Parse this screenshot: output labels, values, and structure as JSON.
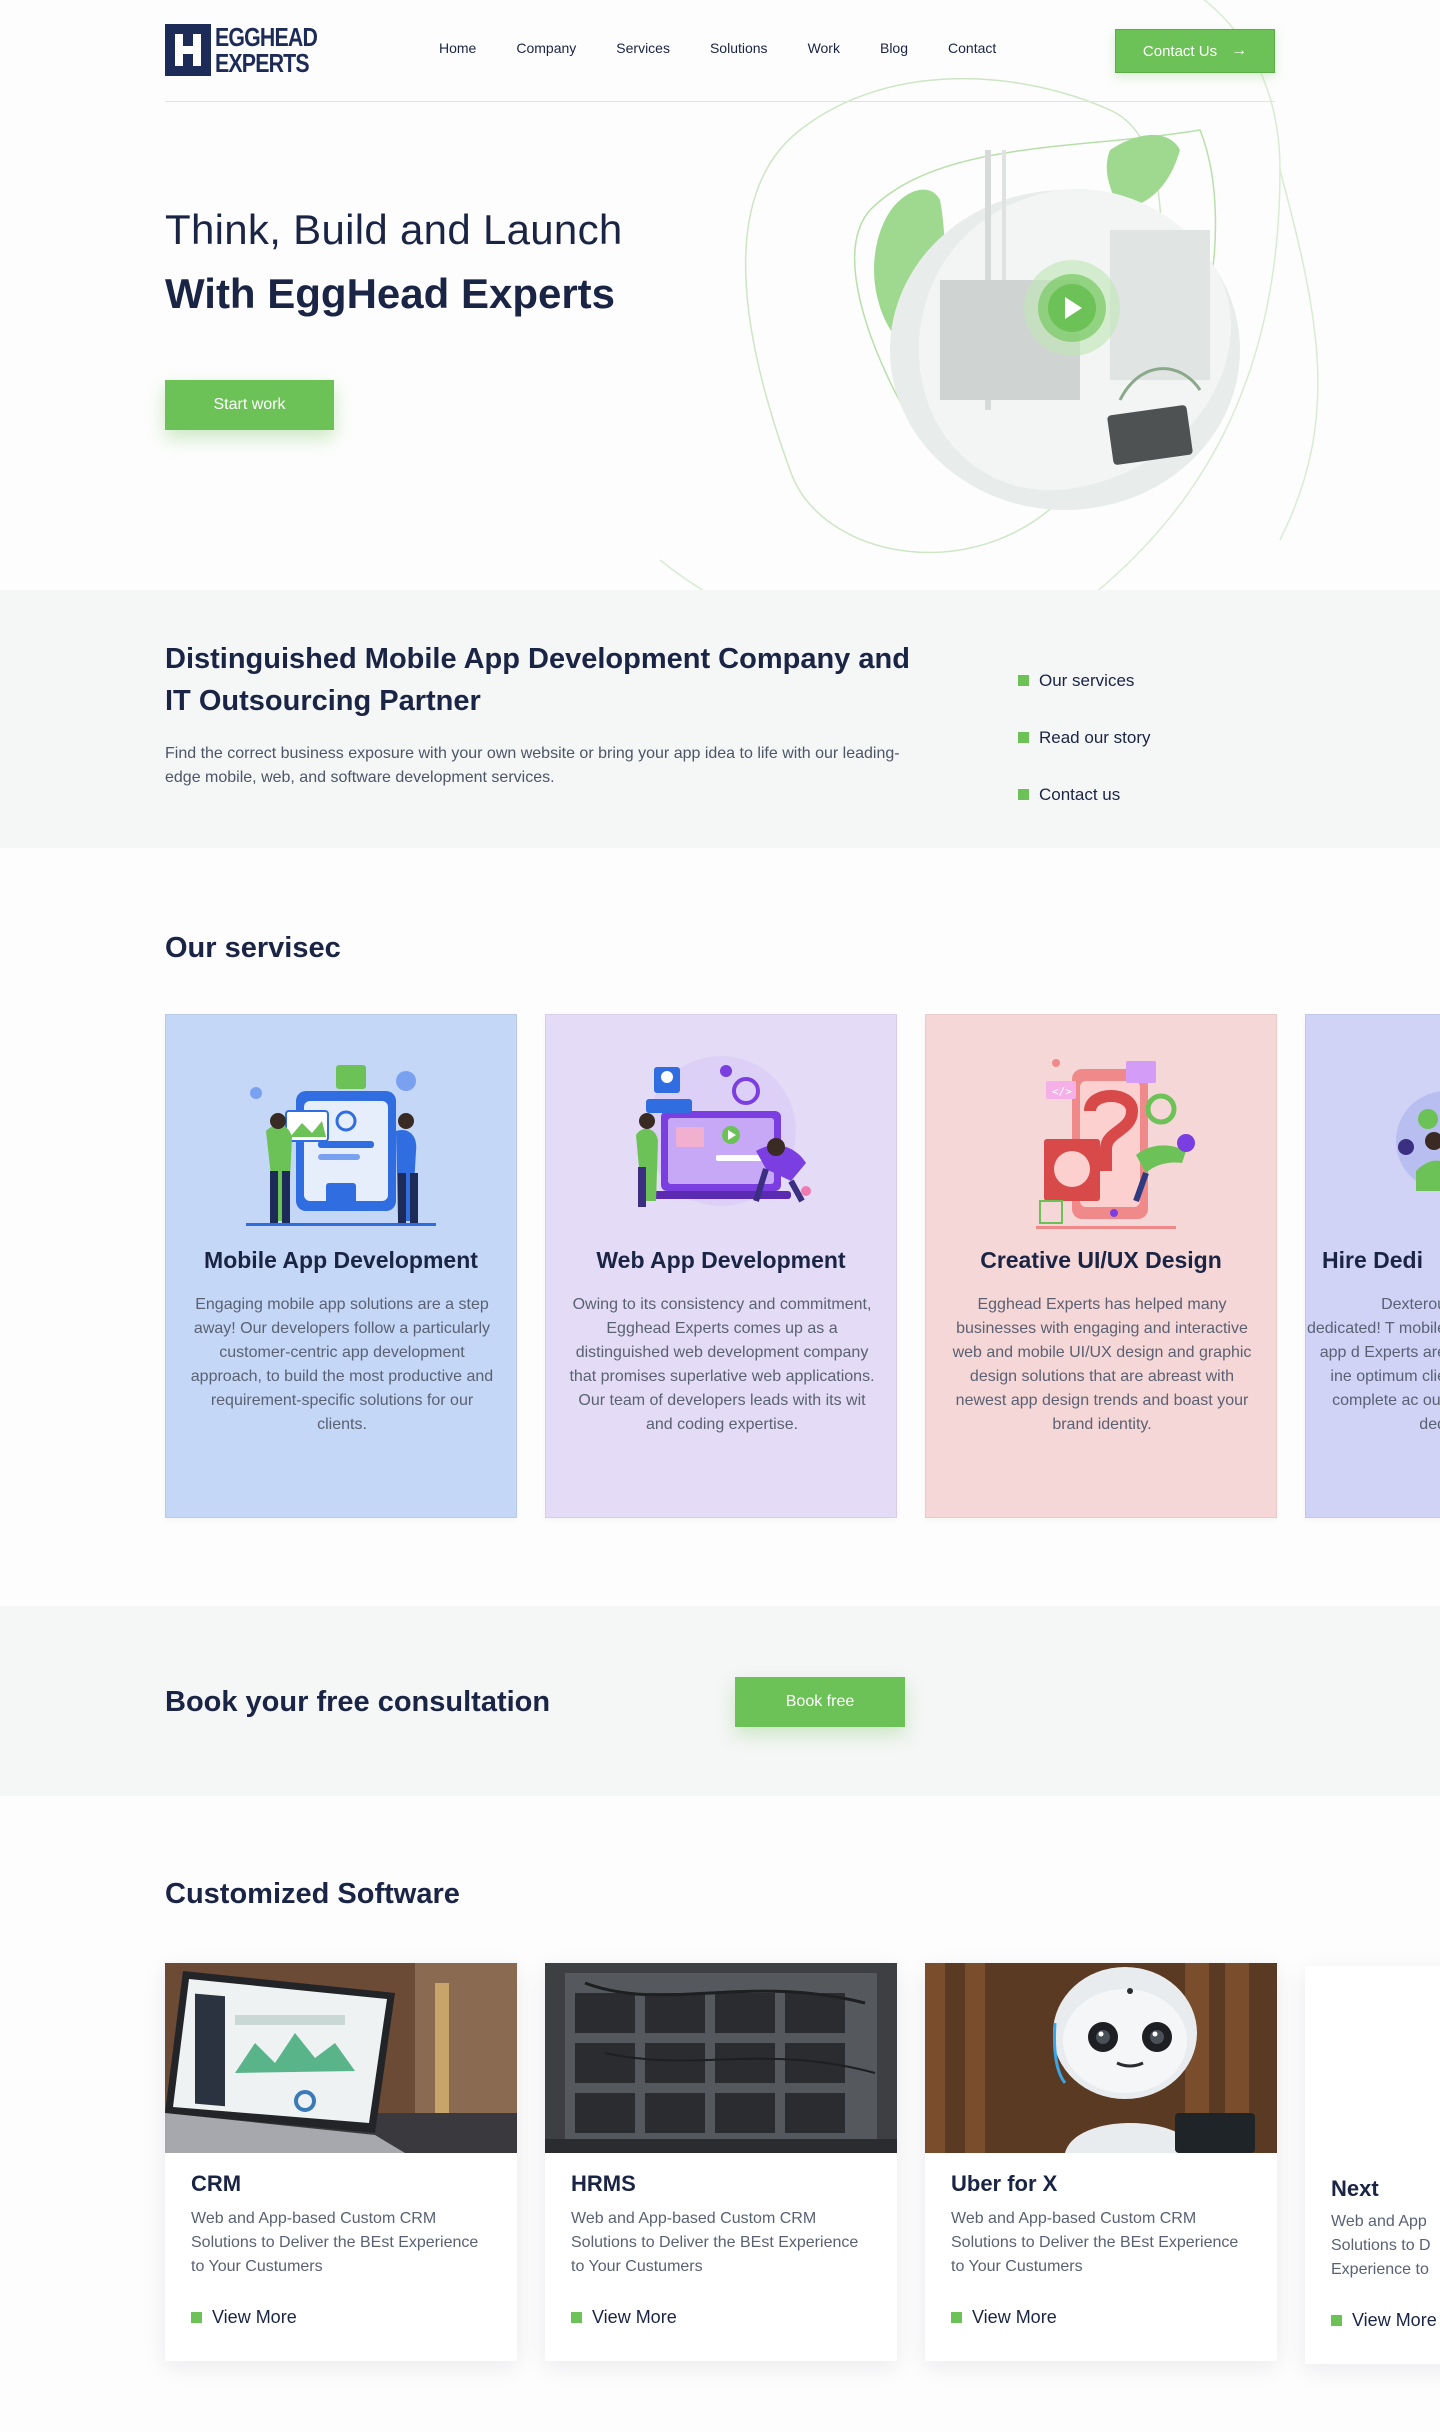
{
  "brand": {
    "logo_line1": "EGGHEAD",
    "logo_line2": "EXPERTS"
  },
  "nav": {
    "items": [
      "Home",
      "Company",
      "Services",
      "Solutions",
      "Work",
      "Blog",
      "Contact"
    ]
  },
  "header": {
    "cta_label": "Contact Us",
    "cta_icon": "arrow-right-icon"
  },
  "hero": {
    "title_line1": "Think, Build and Launch",
    "title_line2": "With EggHead Experts",
    "button_label": "Start work",
    "media_icon": "play-icon"
  },
  "intro": {
    "heading": "Distinguished Mobile App Development Company and IT Outsourcing Partner",
    "body": "Find the correct business exposure with your own website or bring your app idea to life with our leading-edge mobile, web, and software development services.",
    "links": [
      "Our services",
      "Read our story",
      "Contact us"
    ]
  },
  "services": {
    "title": "Our servisec",
    "cards": [
      {
        "title": "Mobile App Development",
        "body": "Engaging mobile app solutions are a step away! Our developers follow a particularly customer-centric app development approach, to build the most productive and requirement-specific solutions for our clients.",
        "bg": "#c5d7f6"
      },
      {
        "title": "Web App Development",
        "body": "Owing to its consistency and commitment, Egghead Experts comes up as a distinguished web development company that promises superlative web applications. Our team of developers leads with its wit and coding expertise.",
        "bg": "#e4dcf6"
      },
      {
        "title": "Creative UI/UX Design",
        "body": "Egghead Experts has helped many businesses with engaging and interactive web and mobile UI/UX design and graphic design solutions that are abreast with newest app design trends and boast your brand identity.",
        "bg": "#f6d7d7"
      },
      {
        "title": "Hire Dedi",
        "body": "Dexterou dedicated! T mobile app d Experts are ine optimum clie complete ac our ded",
        "bg": "#d0d3f6"
      }
    ]
  },
  "consult": {
    "heading": "Book your free consultation",
    "button_label": "Book free"
  },
  "software": {
    "title": "Customized Software",
    "more_label": "View More",
    "cards": [
      {
        "title": "CRM",
        "body": "Web and App-based Custom CRM Solutions to Deliver the BEst Experience to Your Custumers"
      },
      {
        "title": "HRMS",
        "body": "Web and App-based Custom CRM Solutions to Deliver the BEst Experience to Your Custumers"
      },
      {
        "title": "Uber for X",
        "body": "Web and App-based Custom CRM Solutions to Deliver the BEst Experience to Your Custumers"
      },
      {
        "title": "Next",
        "body": "Web and App Solutions to D Experience to",
        "more": "View More"
      }
    ]
  },
  "colors": {
    "accent": "#6cc257",
    "navy": "#1a2444",
    "band": "#f5f6f6"
  }
}
